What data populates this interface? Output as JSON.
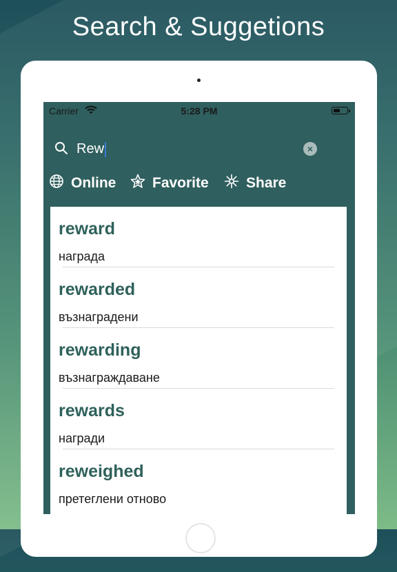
{
  "headline": "Search & Suggetions",
  "status_bar": {
    "carrier": "Carrier",
    "time": "5:28 PM",
    "wifi_icon": "wifi-icon",
    "battery_icon": "battery-icon"
  },
  "search": {
    "value": "Rew",
    "icon": "search-icon",
    "clear_icon": "clear-icon"
  },
  "toolbar": {
    "online_label": "Online",
    "favorite_label": "Favorite",
    "share_label": "Share"
  },
  "results": [
    {
      "word": "reward",
      "translation": "награда"
    },
    {
      "word": "rewarded",
      "translation": "възнаградени"
    },
    {
      "word": "rewarding",
      "translation": "възнаграждаване"
    },
    {
      "word": "rewards",
      "translation": "награди"
    },
    {
      "word": "reweighed",
      "translation": "претеглени отново"
    }
  ],
  "colors": {
    "accent": "#2f615b",
    "header_bg": "#2f5f5e",
    "caret": "#3a7bd5"
  }
}
